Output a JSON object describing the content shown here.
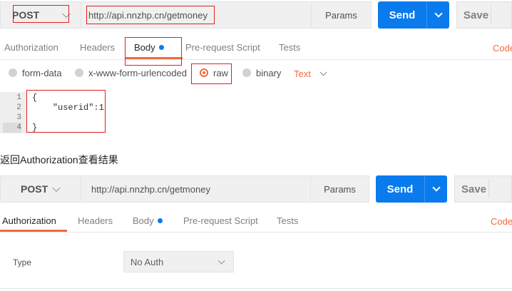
{
  "top": {
    "method": "POST",
    "url": "http://api.nnzhp.cn/getmoney",
    "params_label": "Params",
    "send_label": "Send",
    "save_label": "Save",
    "tabs": [
      {
        "label": "Authorization"
      },
      {
        "label": "Headers"
      },
      {
        "label": "Body"
      },
      {
        "label": "Pre-request Script"
      },
      {
        "label": "Tests"
      }
    ],
    "code_link": "Code",
    "body_types": [
      {
        "label": "form-data"
      },
      {
        "label": "x-www-form-urlencoded"
      },
      {
        "label": "raw"
      },
      {
        "label": "binary"
      }
    ],
    "content_type": "Text",
    "editor": {
      "line_numbers": [
        "1",
        "2",
        "3",
        "4"
      ],
      "lines": [
        "{",
        "    \"userid\":1",
        "",
        "}"
      ]
    }
  },
  "caption": "返回Authorization查看结果",
  "bottom": {
    "method": "POST",
    "url": "http://api.nnzhp.cn/getmoney",
    "params_label": "Params",
    "send_label": "Send",
    "save_label": "Save",
    "tabs": [
      {
        "label": "Authorization"
      },
      {
        "label": "Headers"
      },
      {
        "label": "Body"
      },
      {
        "label": "Pre-request Script"
      },
      {
        "label": "Tests"
      }
    ],
    "code_link": "Code",
    "type_label": "Type",
    "auth_value": "No Auth"
  },
  "colors": {
    "accent": "#f26b3a",
    "send": "#097bed",
    "annotation": "#e02020"
  }
}
